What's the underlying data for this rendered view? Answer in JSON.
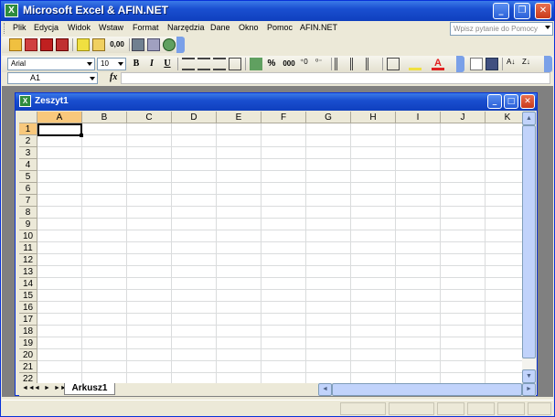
{
  "app": {
    "title": "Microsoft Excel & AFIN.NET",
    "icon": "excel-icon"
  },
  "menu": {
    "items": [
      "Plik",
      "Edycja",
      "Widok",
      "Wstaw",
      "Format",
      "Narzędzia",
      "Dane",
      "Okno",
      "Pomoc",
      "AFIN.NET"
    ]
  },
  "help": {
    "placeholder": "Wpisz pytanie do Pomocy"
  },
  "toolbar1": {
    "icons": [
      "open-icon",
      "unprotect-icon",
      "save-icon",
      "copy-icon",
      "highlight-icon",
      "calculator-icon",
      "decimal-icon",
      "workbook-icon",
      "export-icon",
      "help-icon"
    ],
    "decimal_label": "0,00"
  },
  "toolbar2": {
    "font_name": "Arial",
    "font_size": "10",
    "bold": "B",
    "italic": "I",
    "underline": "U",
    "percent": "%",
    "thousands": "000"
  },
  "formula": {
    "name_box": "A1",
    "fx": "fx",
    "value": ""
  },
  "workbook": {
    "title": "Zeszyt1"
  },
  "sheet": {
    "columns": [
      "A",
      "B",
      "C",
      "D",
      "E",
      "F",
      "G",
      "H",
      "I",
      "J",
      "K"
    ],
    "rows": [
      "1",
      "2",
      "3",
      "4",
      "5",
      "6",
      "7",
      "8",
      "9",
      "10",
      "11",
      "12",
      "13",
      "14",
      "15",
      "16",
      "17",
      "18",
      "19",
      "20",
      "21",
      "22"
    ],
    "active_cell": "A1"
  },
  "tabs": {
    "items": [
      "Arkusz1"
    ],
    "nav": [
      "◄◄",
      "◄",
      "►",
      "►►"
    ]
  },
  "colors": {
    "accent": "#0831d9",
    "selection": "#f8c87c"
  }
}
